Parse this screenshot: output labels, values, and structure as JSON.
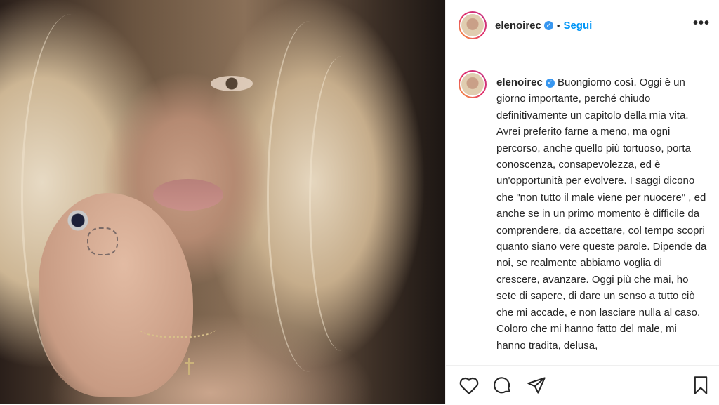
{
  "post": {
    "username": "elenoirec",
    "verified_mark": "✓",
    "separator": "•",
    "follow_label": "Segui",
    "more_label": "•••",
    "caption": "Buongiorno così. Oggi è un giorno importante, perché chiudo definitivamente un capitolo della mia vita. Avrei preferito farne a meno, ma ogni percorso, anche quello più tortuoso, porta conoscenza, consapevolezza, ed è un'opportunità per evolvere. I saggi dicono che \"non tutto il male viene per nuocere\" , ed anche se in un primo momento è difficile da comprendere, da accettare, col tempo scopri quanto siano vere queste parole. Dipende da noi, se realmente abbiamo voglia di crescere, avanzare. Oggi più che mai, ho sete di sapere, di dare un senso a tutto ciò che mi accade, e non lasciare nulla al caso. Coloro che mi hanno fatto del male, mi hanno tradita, delusa,"
  },
  "actions": {
    "icons": [
      "heart-icon",
      "comment-icon",
      "share-icon",
      "bookmark-icon"
    ]
  },
  "colors": {
    "accent": "#0095f6",
    "verified": "#3897f0",
    "text": "#262626",
    "divider": "#efefef"
  }
}
